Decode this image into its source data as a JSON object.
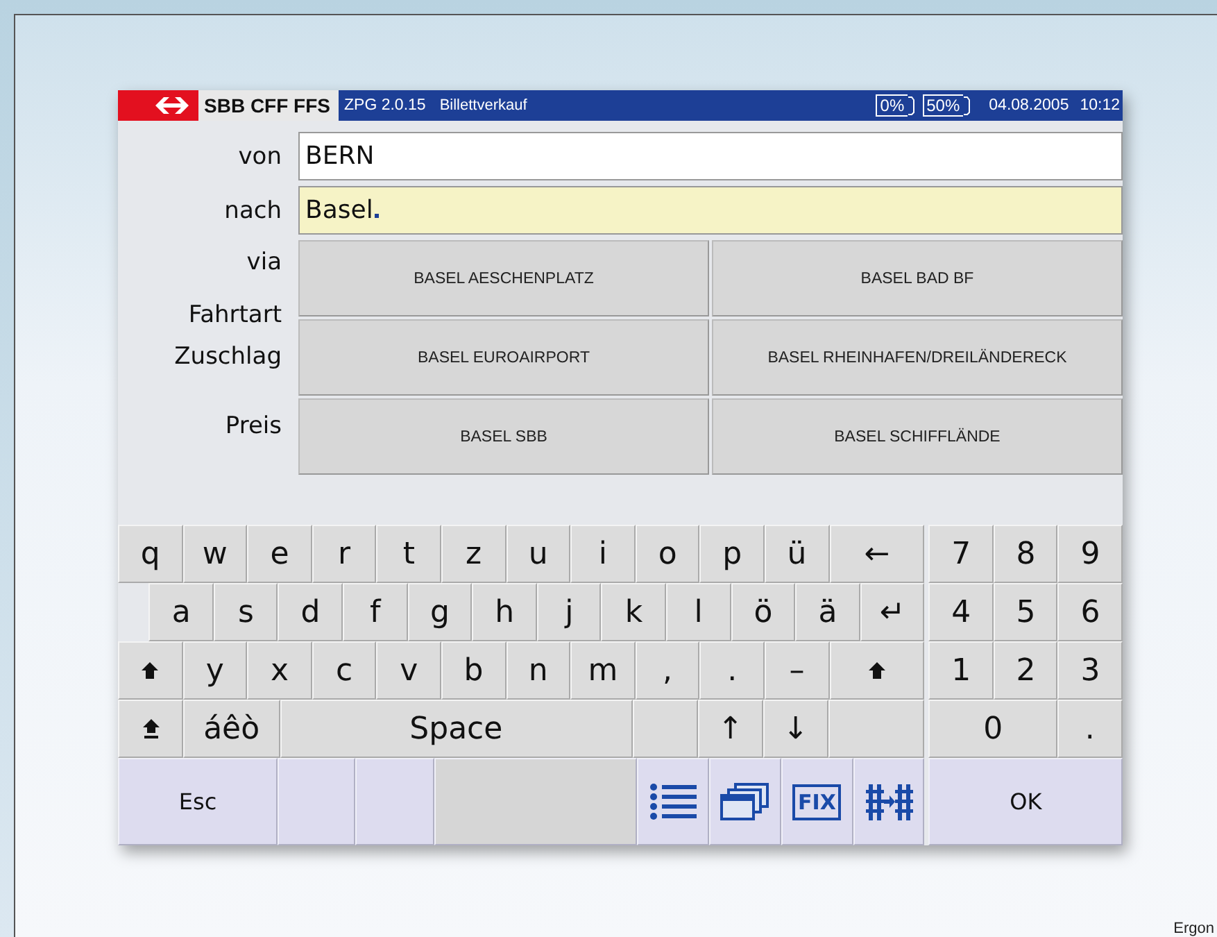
{
  "header": {
    "brand": "SBB CFF FFS",
    "version": "ZPG 2.0.15",
    "app": "Billettverkauf",
    "indicators": [
      "0%",
      "50%"
    ],
    "date": "04.08.2005",
    "time": "10:12"
  },
  "form": {
    "fields": [
      {
        "label": "von",
        "value": "BERN",
        "focused": false
      },
      {
        "label": "nach",
        "value": "Basel",
        "focused": true
      }
    ],
    "labels": [
      "via",
      "Fahrtart",
      "Zuschlag",
      "Preis"
    ],
    "suggestions": [
      "BASEL AESCHENPLATZ",
      "BASEL BAD BF",
      "BASEL EUROAIRPORT",
      "BASEL RHEINHAFEN/DREILÄNDERECK",
      "BASEL SBB",
      "BASEL SCHIFFLÄNDE"
    ]
  },
  "keyboard": {
    "letter_rows": [
      [
        {
          "kind": "key",
          "label": "q"
        },
        {
          "kind": "key",
          "label": "w"
        },
        {
          "kind": "key",
          "label": "e"
        },
        {
          "kind": "key",
          "label": "r"
        },
        {
          "kind": "key",
          "label": "t"
        },
        {
          "kind": "key",
          "label": "z"
        },
        {
          "kind": "key",
          "label": "u"
        },
        {
          "kind": "key",
          "label": "i"
        },
        {
          "kind": "key",
          "label": "o"
        },
        {
          "kind": "key",
          "label": "p"
        },
        {
          "kind": "key",
          "label": "ü"
        },
        {
          "kind": "wide",
          "label": "←"
        }
      ],
      [
        {
          "kind": "indent"
        },
        {
          "kind": "key",
          "label": "a"
        },
        {
          "kind": "key",
          "label": "s"
        },
        {
          "kind": "key",
          "label": "d"
        },
        {
          "kind": "key",
          "label": "f"
        },
        {
          "kind": "key",
          "label": "g"
        },
        {
          "kind": "key",
          "label": "h"
        },
        {
          "kind": "key",
          "label": "j"
        },
        {
          "kind": "key",
          "label": "k"
        },
        {
          "kind": "key",
          "label": "l"
        },
        {
          "kind": "key",
          "label": "ö"
        },
        {
          "kind": "key",
          "label": "ä"
        },
        {
          "kind": "key",
          "label": "↵"
        }
      ],
      [
        {
          "kind": "shift"
        },
        {
          "kind": "key",
          "label": "y"
        },
        {
          "kind": "key",
          "label": "x"
        },
        {
          "kind": "key",
          "label": "c"
        },
        {
          "kind": "key",
          "label": "v"
        },
        {
          "kind": "key",
          "label": "b"
        },
        {
          "kind": "key",
          "label": "n"
        },
        {
          "kind": "key",
          "label": "m"
        },
        {
          "kind": "key",
          "label": ","
        },
        {
          "kind": "key",
          "label": "."
        },
        {
          "kind": "key",
          "label": "–"
        },
        {
          "kind": "shiftwide"
        }
      ],
      [
        {
          "kind": "capslock"
        },
        {
          "kind": "wide",
          "label": "áêò"
        },
        {
          "kind": "space",
          "label": "Space"
        },
        {
          "kind": "key"
        },
        {
          "kind": "key",
          "label": "↑"
        },
        {
          "kind": "key",
          "label": "↓"
        },
        {
          "kind": "wide"
        }
      ]
    ],
    "numpad_rows": [
      [
        {
          "kind": "key",
          "label": "7"
        },
        {
          "kind": "key",
          "label": "8"
        },
        {
          "kind": "key",
          "label": "9"
        }
      ],
      [
        {
          "kind": "key",
          "label": "4"
        },
        {
          "kind": "key",
          "label": "5"
        },
        {
          "kind": "key",
          "label": "6"
        }
      ],
      [
        {
          "kind": "key",
          "label": "1"
        },
        {
          "kind": "key",
          "label": "2"
        },
        {
          "kind": "key",
          "label": "3"
        }
      ],
      [
        {
          "kind": "double",
          "label": "0"
        },
        {
          "kind": "key",
          "label": "."
        }
      ]
    ],
    "function_row": [
      {
        "kind": "command",
        "label": "Esc"
      },
      {
        "kind": "blank"
      },
      {
        "kind": "blank"
      },
      {
        "kind": "gap"
      },
      {
        "kind": "list"
      },
      {
        "kind": "windows"
      },
      {
        "kind": "boxed",
        "label": "FIX"
      },
      {
        "kind": "rails"
      }
    ],
    "ok": "OK"
  },
  "caption": "Ergon"
}
